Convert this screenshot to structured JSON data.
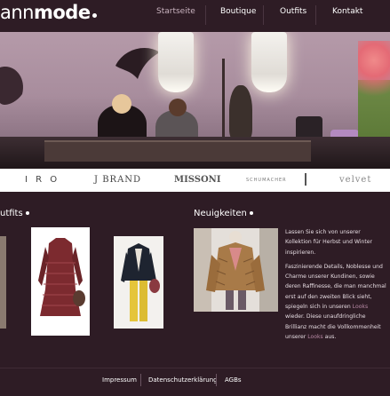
{
  "logo": {
    "light": "ann",
    "bold": "mode"
  },
  "nav": {
    "items": [
      {
        "label": "Startseite",
        "active": true
      },
      {
        "label": "Boutique",
        "active": false
      },
      {
        "label": "Outfits",
        "active": false
      },
      {
        "label": "Kontakt",
        "active": false
      }
    ]
  },
  "brands": [
    "I R O",
    "J BRAND",
    "MISSONI",
    "SCHUMACHER",
    "velvet"
  ],
  "sections": {
    "outfits_title": "utfits",
    "news_title": "Neuigkeiten"
  },
  "news": {
    "p1": "Lassen Sie sich von unserer Kollektion für Herbst und Winter inspirieren.",
    "p2_before": "Faszinierende Details, Noblesse und Charme unserer Kundinen, sowie deren Raffinesse, die man manchmal erst auf den zweiten Blick sieht, spiegeln sich in unseren ",
    "p2_link": "Looks",
    "p2_after": " wieder. Diese unaufdringliche Brillianz macht die Vollkommenheit unserer ",
    "p2_link2": "Looks",
    "p2_end": " aus."
  },
  "footer": {
    "items": [
      "Impressum",
      "Datenschutzerklärung",
      "AGBs"
    ]
  },
  "colors": {
    "background": "#2e1c25",
    "accent_link": "#b98aa6",
    "brandbar": "#ffffff"
  }
}
